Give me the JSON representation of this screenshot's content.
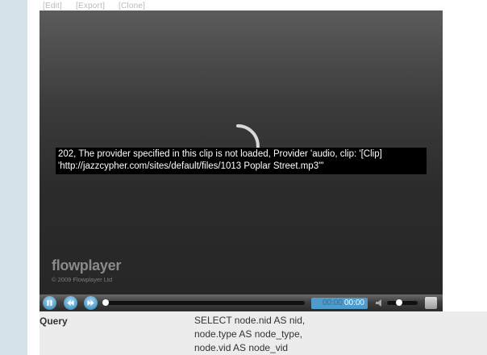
{
  "actions": {
    "edit": "[Edit]",
    "export": "[Export]",
    "clone": "[Clone]"
  },
  "player": {
    "error_line1": "202, The provider specified in this clip is not loaded, Provider 'audio, clip: '[Clip]",
    "error_line2": "'http://jazzcypher.com/sites/default/files/1013 Poplar Street.mp3'\"",
    "brand": "flowplayer",
    "copyright": "© 2009 Flowplayer Ltd",
    "controls": {
      "pause_icon": "pause-icon",
      "rewind_icon": "rewind-icon",
      "forward_icon": "forward-icon",
      "time_duration": "00:00",
      "time_current": "00:00",
      "volume_level": 0.4
    },
    "accent_color": "#4f9bc9"
  },
  "query": {
    "label": "Query",
    "lines": [
      "SELECT node.nid AS nid,",
      "node.type AS node_type,",
      "node.vid AS node_vid"
    ]
  }
}
